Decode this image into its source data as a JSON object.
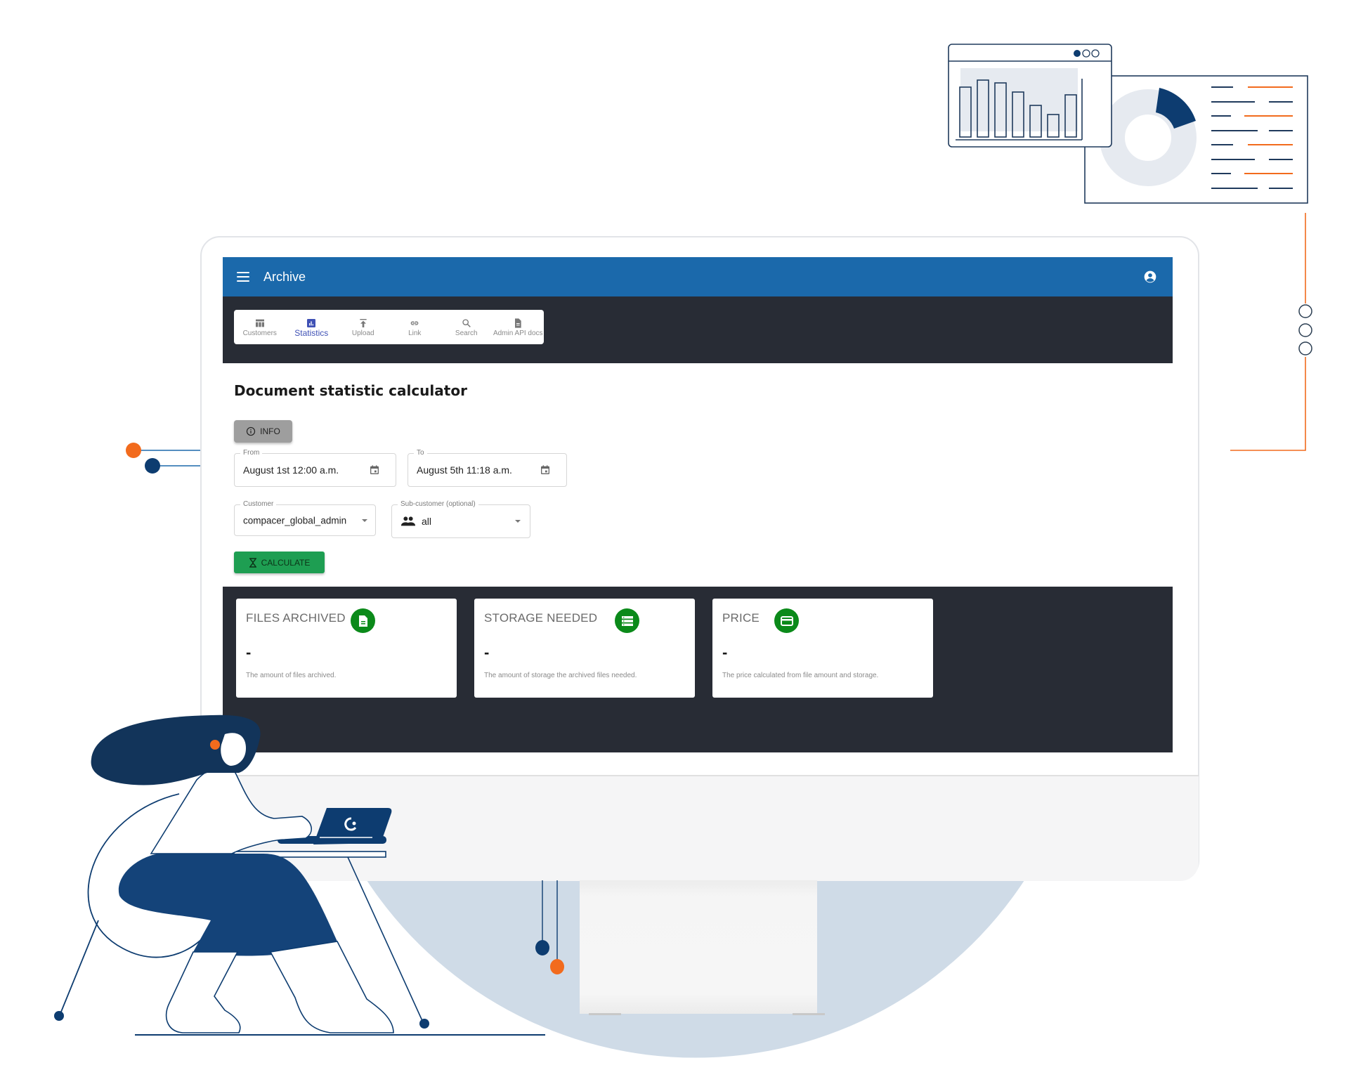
{
  "colors": {
    "appbar": "#1b69ab",
    "dark_band": "#282c35",
    "active_nav": "#3f51b5",
    "calculate": "#1e9e52",
    "card_icon": "#0b8a1a",
    "accent_orange": "#f26b1d",
    "navy": "#0d3c70"
  },
  "appbar": {
    "title": "Archive",
    "menu_icon": "hamburger-menu-icon",
    "user_icon": "account-circle-icon"
  },
  "nav": {
    "items": [
      {
        "label": "Customers",
        "icon": "table-icon",
        "active": false
      },
      {
        "label": "Statistics",
        "icon": "bar-chart-icon",
        "active": true
      },
      {
        "label": "Upload",
        "icon": "upload-icon",
        "active": false
      },
      {
        "label": "Link",
        "icon": "link-icon",
        "active": false
      },
      {
        "label": "Search",
        "icon": "search-icon",
        "active": false
      },
      {
        "label": "Admin API docs",
        "icon": "document-icon",
        "active": false
      }
    ]
  },
  "page": {
    "title": "Document statistic calculator",
    "info_button": "INFO",
    "from": {
      "label": "From",
      "value": "August 1st 12:00 a.m."
    },
    "to": {
      "label": "To",
      "value": "August 5th 11:18 a.m."
    },
    "customer": {
      "label": "Customer",
      "value": "compacer_global_admin"
    },
    "sub_customer": {
      "label": "Sub-customer (optional)",
      "value": "all"
    },
    "calculate_button": "CALCULATE"
  },
  "results": {
    "cards": [
      {
        "title": "FILES ARCHIVED",
        "icon": "file-icon",
        "value": "-",
        "description": "The amount of files archived."
      },
      {
        "title": "STORAGE NEEDED",
        "icon": "storage-icon",
        "value": "-",
        "description": "The amount of storage the archived files needed."
      },
      {
        "title": "PRICE",
        "icon": "credit-card-icon",
        "value": "-",
        "description": "The price calculated from file amount and storage."
      }
    ]
  }
}
